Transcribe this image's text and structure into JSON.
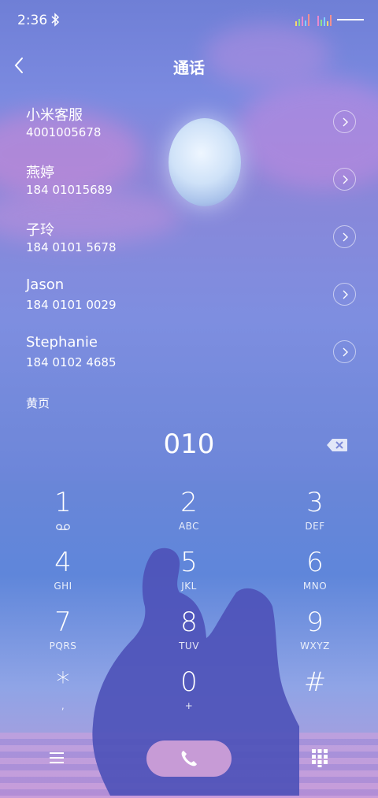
{
  "status": {
    "time": "2:36",
    "icons": [
      "bluetooth-icon",
      "signal-icon",
      "signal-icon",
      "battery-icon"
    ]
  },
  "header": {
    "title": "通话",
    "back_icon": "chevron-left-icon"
  },
  "contacts": [
    {
      "name": "小米客服",
      "number": "4001005678"
    },
    {
      "name": "燕婷",
      "number": "184 01015689"
    },
    {
      "name": "子玲",
      "number": "184 0101 5678"
    },
    {
      "name": "Jason",
      "number": "184 0101 0029"
    },
    {
      "name": "Stephanie",
      "number": "184 0102 4685"
    }
  ],
  "section": {
    "label": "黄页"
  },
  "dialer": {
    "number": "010",
    "keys": [
      {
        "digit": "1",
        "letters": "",
        "icon": "voicemail-icon"
      },
      {
        "digit": "2",
        "letters": "ABC"
      },
      {
        "digit": "3",
        "letters": "DEF"
      },
      {
        "digit": "4",
        "letters": "GHI"
      },
      {
        "digit": "5",
        "letters": "JKL"
      },
      {
        "digit": "6",
        "letters": "MNO"
      },
      {
        "digit": "7",
        "letters": "PQRS"
      },
      {
        "digit": "8",
        "letters": "TUV"
      },
      {
        "digit": "9",
        "letters": "WXYZ"
      },
      {
        "digit": "*",
        "letters": ","
      },
      {
        "digit": "0",
        "letters": "+"
      },
      {
        "digit": "#",
        "letters": ""
      }
    ]
  },
  "bottom": {
    "icons": [
      "menu-icon",
      "phone-icon",
      "dialpad-icon"
    ]
  },
  "colors": {
    "call_button": "#c79bd6",
    "text": "#ffffff"
  }
}
